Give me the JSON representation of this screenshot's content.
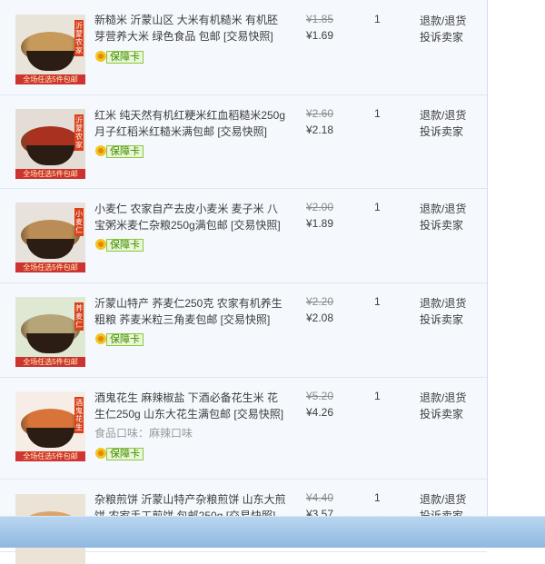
{
  "orders": [
    {
      "title": "新糙米 沂蒙山区 大米有机糙米 有机胚芽营养大米 绿色食品 包邮 [交易快照]",
      "tag": "沂蒙农家",
      "banner": "全场任选5件包邮",
      "flavor": "",
      "badge": "保障卡",
      "old_price": "¥1.85",
      "new_price": "¥1.69",
      "qty": "1",
      "action1": "退款/退货",
      "action2": "投诉卖家",
      "grain_color": "#c79a5b",
      "bg_color": "#e9e4da"
    },
    {
      "title": "红米 纯天然有机红粳米红血稻糙米250g 月子红稻米红糙米满包邮 [交易快照]",
      "tag": "沂蒙农家",
      "banner": "全场任选5件包邮",
      "flavor": "",
      "badge": "保障卡",
      "old_price": "¥2.60",
      "new_price": "¥2.18",
      "qty": "1",
      "action1": "退款/退货",
      "action2": "投诉卖家",
      "grain_color": "#a8321f",
      "bg_color": "#e4ddd6"
    },
    {
      "title": "小麦仁 农家自产去皮小麦米 麦子米 八宝粥米麦仁杂粮250g满包邮 [交易快照]",
      "tag": "小麦仁",
      "banner": "全场任选5件包邮",
      "flavor": "",
      "badge": "保障卡",
      "old_price": "¥2.00",
      "new_price": "¥1.89",
      "qty": "1",
      "action1": "退款/退货",
      "action2": "投诉卖家",
      "grain_color": "#b98d55",
      "bg_color": "#e7e2db"
    },
    {
      "title": "沂蒙山特产 荞麦仁250克 农家有机养生粗粮 荞麦米粒三角麦包邮 [交易快照]",
      "tag": "荞麦仁",
      "banner": "全场任选5件包邮",
      "flavor": "",
      "badge": "保障卡",
      "old_price": "¥2.20",
      "new_price": "¥2.08",
      "qty": "1",
      "action1": "退款/退货",
      "action2": "投诉卖家",
      "grain_color": "#b7a57a",
      "bg_color": "#dfe8d3"
    },
    {
      "title": "酒鬼花生 麻辣椒盐 下酒必备花生米 花生仁250g 山东大花生满包邮 [交易快照]",
      "tag": "酒鬼花生",
      "banner": "全场任选5件包邮",
      "flavor": "食品口味：麻辣口味",
      "badge": "保障卡",
      "old_price": "¥5.20",
      "new_price": "¥4.26",
      "qty": "1",
      "action1": "退款/退货",
      "action2": "投诉卖家",
      "grain_color": "#d8743a",
      "bg_color": "#f6eee6"
    },
    {
      "title": "杂粮煎饼 沂蒙山特产杂粮煎饼 山东大煎饼 农家手工煎饼 包邮250g [交易快照]",
      "tag": "",
      "banner": "",
      "flavor": "",
      "badge": "",
      "old_price": "¥4.40",
      "new_price": "¥3.57",
      "qty": "1",
      "action1": "退款/退货",
      "action2": "投诉卖家",
      "grain_color": "#d9a56a",
      "bg_color": "#ece3d7"
    }
  ]
}
